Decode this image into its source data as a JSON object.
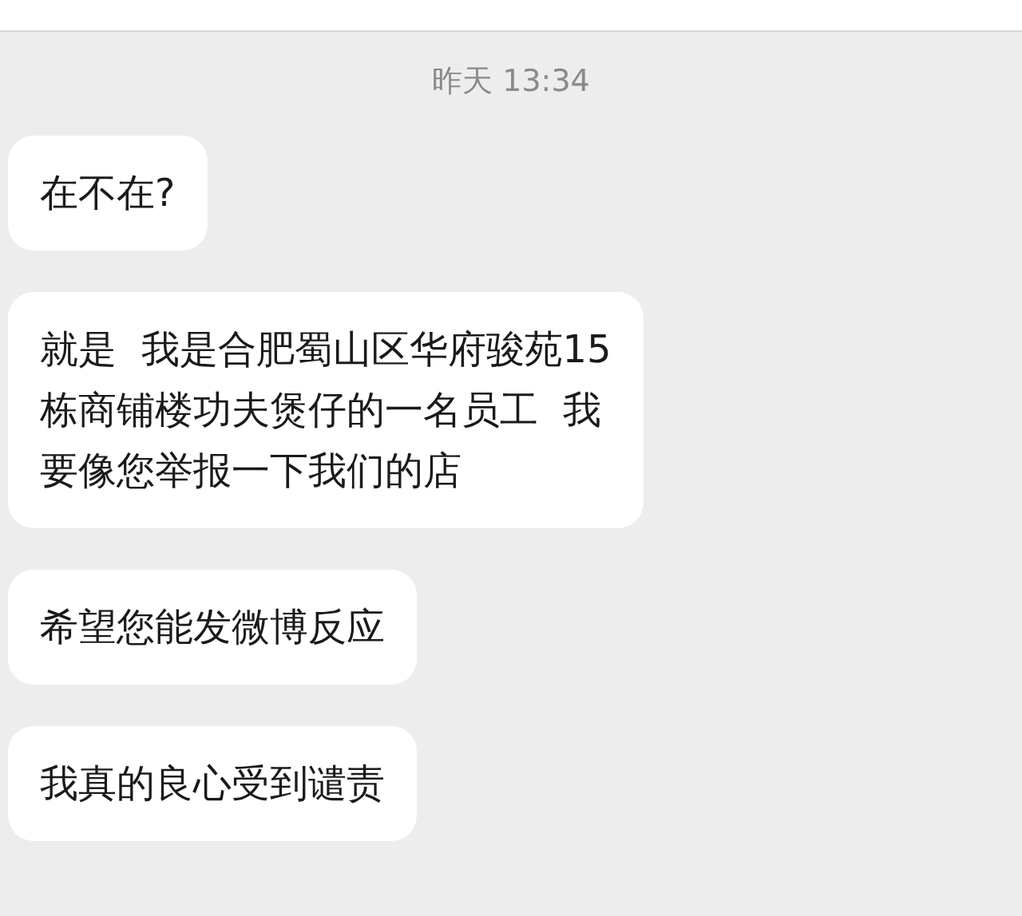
{
  "timestamp": "昨天 13:34",
  "messages": [
    {
      "lines": [
        "在不在?"
      ]
    },
    {
      "lines": [
        "就是  我是合肥蜀山区华府骏苑15",
        "栋商铺楼功夫煲仔的一名员工  我",
        "要像您举报一下我们的店"
      ]
    },
    {
      "lines": [
        "希望您能发微博反应"
      ]
    },
    {
      "lines": [
        "我真的良心受到谴责"
      ]
    }
  ]
}
